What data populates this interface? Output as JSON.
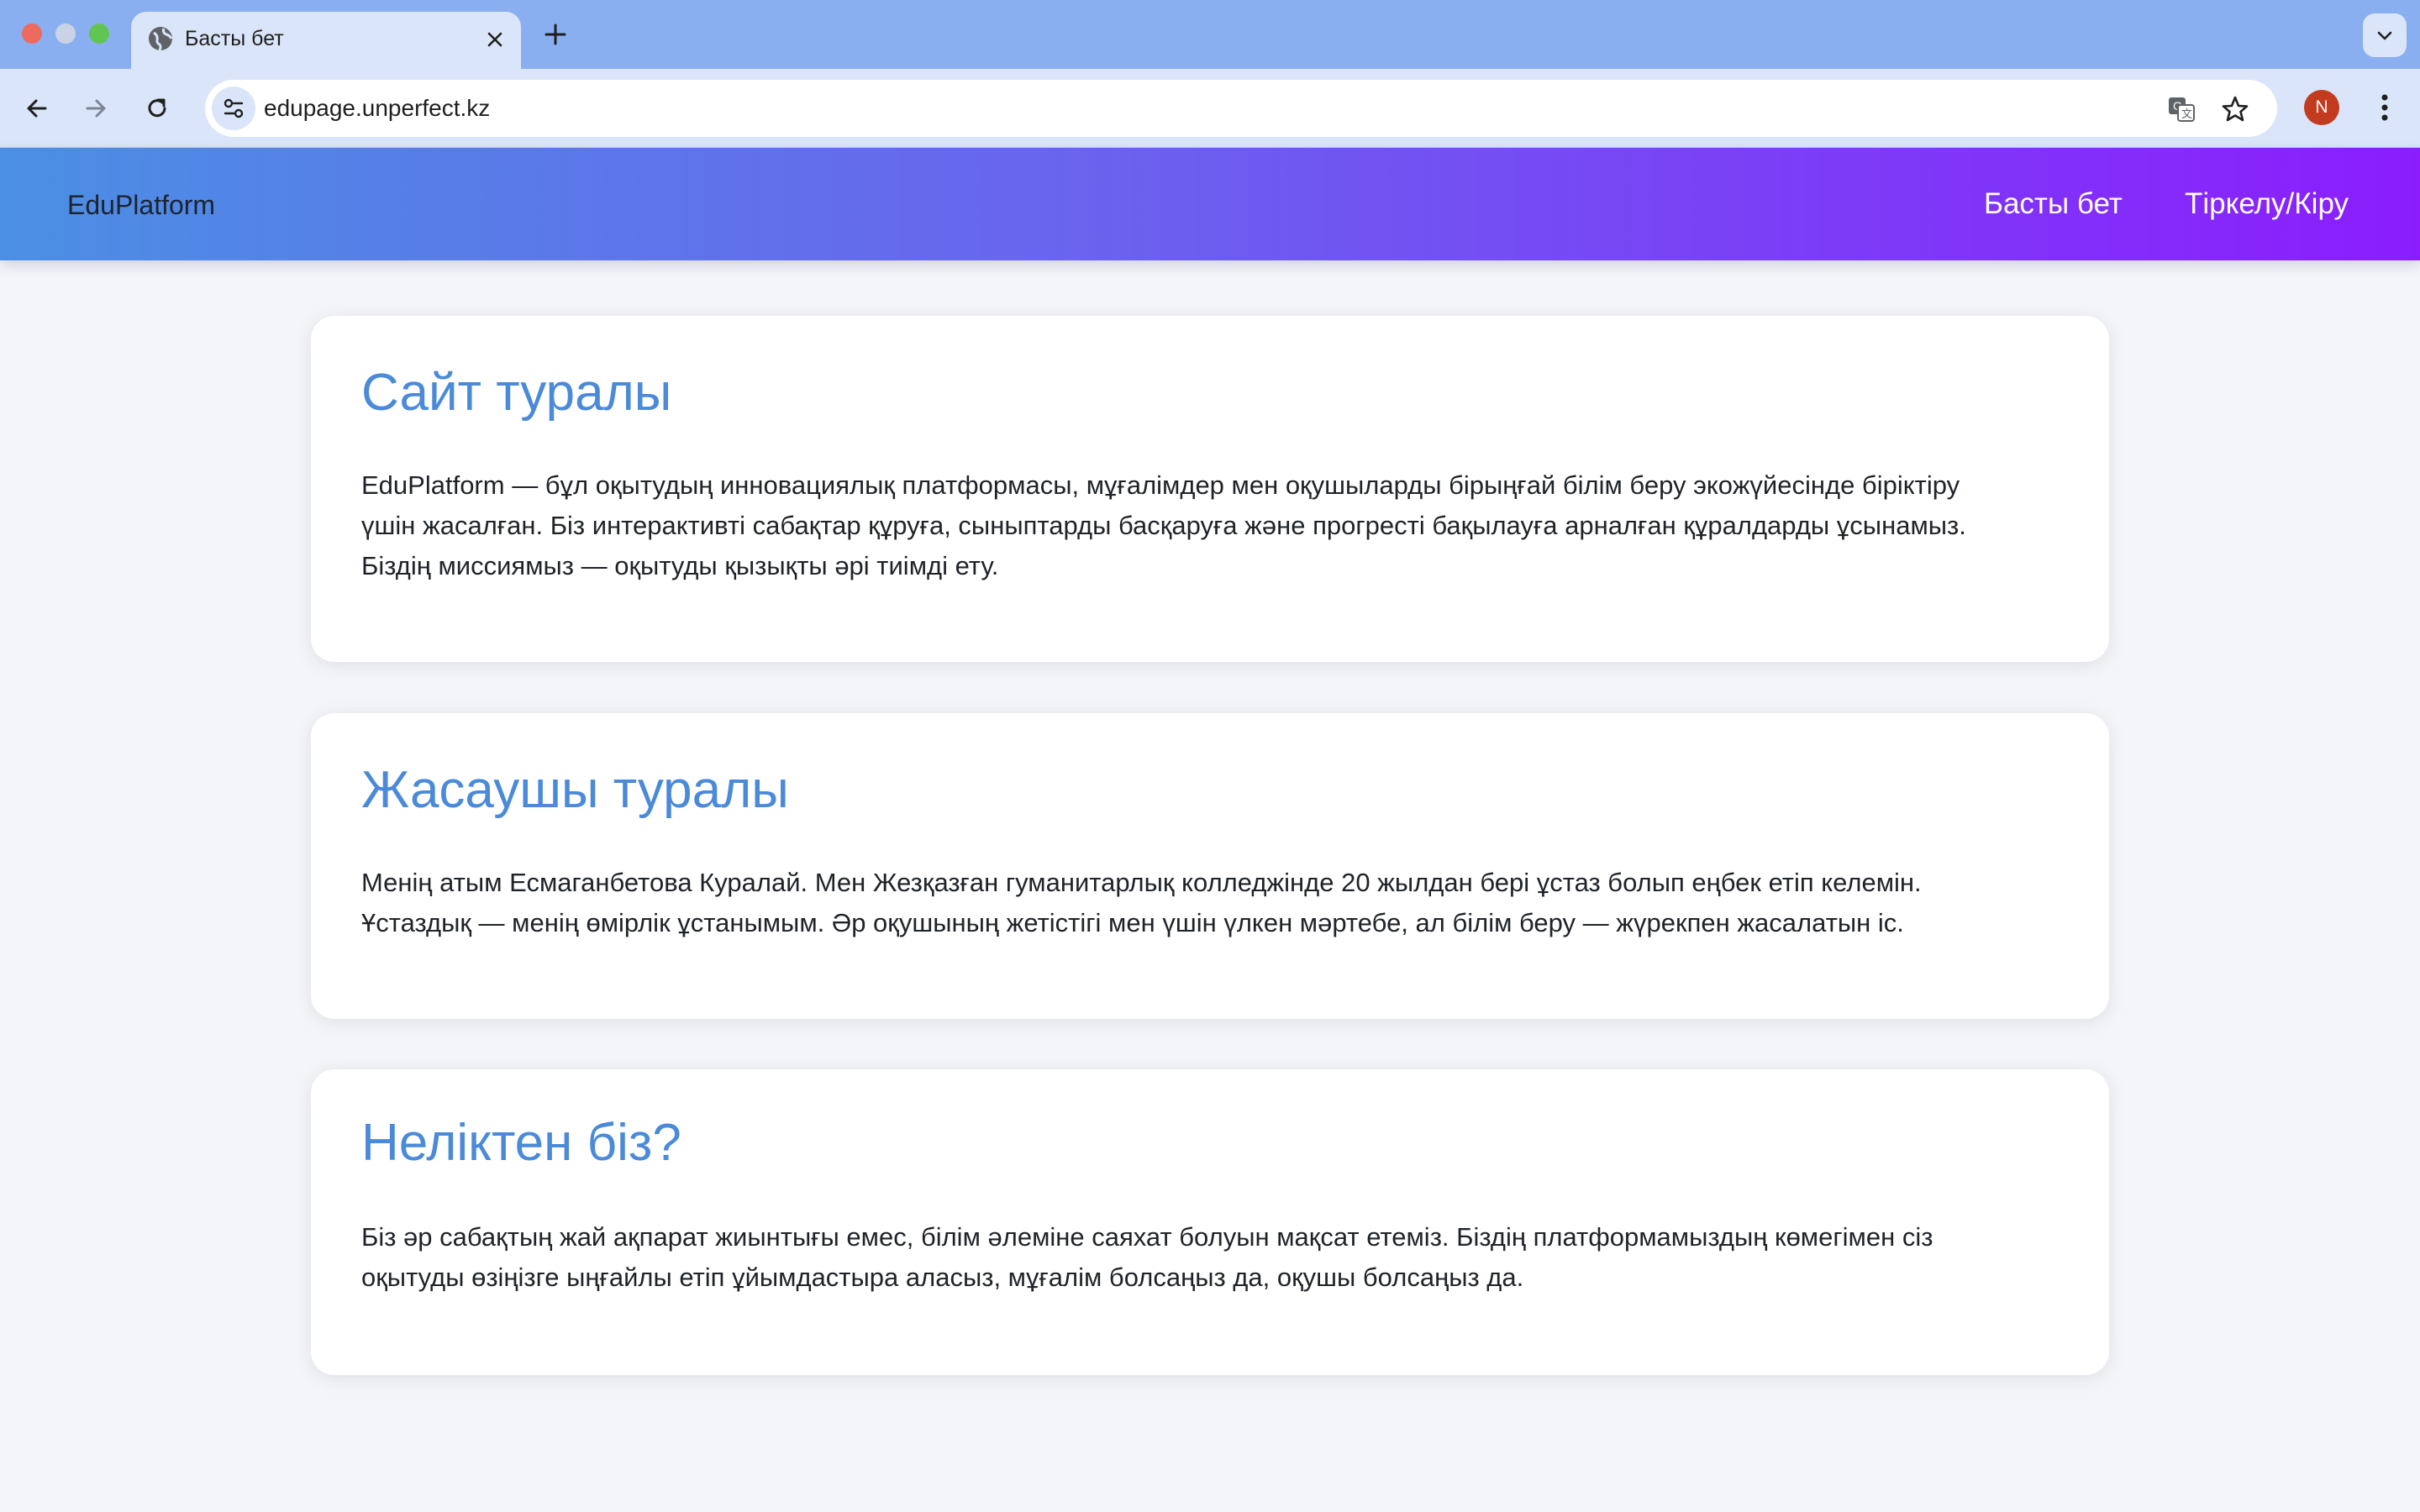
{
  "browser": {
    "tab_title": "Басты бет",
    "url": "edupage.unperfect.kz",
    "profile_initial": "N",
    "icons": [
      "globe-icon",
      "close-icon",
      "plus-icon",
      "chevron-down-icon",
      "back-arrow-icon",
      "forward-arrow-icon",
      "reload-icon",
      "site-settings-icon",
      "translate-icon",
      "star-icon",
      "kebab-menu-icon"
    ]
  },
  "header": {
    "logo": "EduPlatform",
    "nav": [
      "Басты бет",
      "Тіркелу/Кіру"
    ]
  },
  "sections": [
    {
      "title": "Сайт туралы",
      "lines": [
        "EduPlatform — бұл оқытудың инновациялық платформасы, мұғалімдер мен оқушыларды бірыңғай білім беру экожүйесінде біріктіру",
        "үшін жасалған. Біз интерактивті сабақтар құруға, сыныптарды басқаруға және прогресті бақылауға арналған құралдарды ұсынамыз.",
        "Біздің миссиямыз — оқытуды қызықты әрі тиімді ету."
      ]
    },
    {
      "title": "Жасаушы туралы",
      "lines": [
        "Менің атым Есмаганбетова Куралай. Мен Жезқазған гуманитарлық колледжінде 20 жылдан бері ұстаз болып еңбек етіп келемін.",
        "Ұстаздық — менің өмірлік ұстанымым. Әр оқушының жетістігі мен үшін үлкен мәртебе, ал білім беру — жүрекпен жасалатын іс."
      ]
    },
    {
      "title": "Неліктен біз?",
      "lines": [
        "Біз әр сабақтың жай ақпарат жиынтығы емес, білім әлеміне саяхат болуын мақсат етеміз. Біздің платформамыздың көмегімен сіз",
        "оқытуды өзіңізге ыңғайлы етіп ұйымдастыра аласыз, мұғалім болсаңыз да, оқушы болсаңыз да."
      ]
    }
  ]
}
